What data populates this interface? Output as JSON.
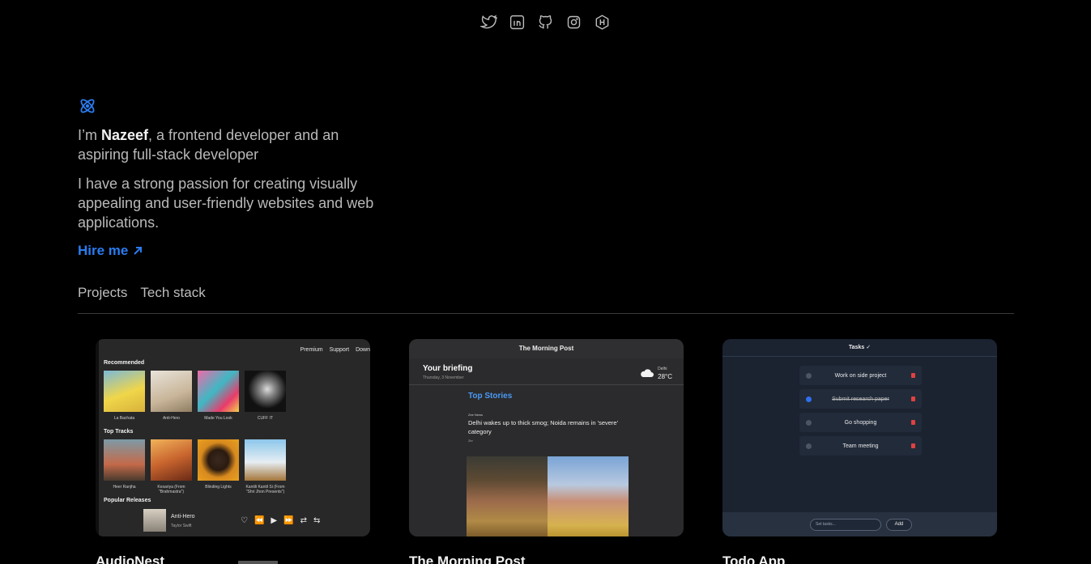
{
  "social": [
    "twitter-icon",
    "linkedin-icon",
    "github-icon",
    "instagram-icon",
    "hashnode-icon"
  ],
  "intro": {
    "prefix": "I’m ",
    "name": "Nazeef",
    "suffix": ", a frontend developer and an aspiring full-stack developer"
  },
  "passion": "I have a strong passion for creating visually appealing and user-friendly websites and web applications.",
  "hire_label": "Hire me",
  "tabs": [
    "Projects",
    "Tech stack"
  ],
  "colors": {
    "accent": "#2a7cf0",
    "background": "#000000"
  },
  "projects": [
    {
      "title": "AudioNest",
      "nav": [
        "Premium",
        "Support",
        "Down"
      ],
      "recommended_label": "Recommended",
      "recommended": [
        "La Bachata",
        "Anti-Hero",
        "Made You Look",
        "CUFF IT"
      ],
      "top_tracks_label": "Top Tracks",
      "top_tracks": [
        "Heer Ranjha",
        "Kesariya (From \"Brahmastra\")",
        "Blinding Lights",
        "Kantili Kantil Si (From \"Shri Jhon Presents\")"
      ],
      "popular_label": "Popular Releases",
      "now_playing": {
        "track": "Anti-Hero",
        "artist": "Taylor Swift"
      }
    },
    {
      "title": "The Morning Post",
      "header": "The Morning Post",
      "briefing": "Your briefing",
      "date": "Thursday, 3 November",
      "weather": {
        "city": "Delhi",
        "temp": "28°C"
      },
      "top_stories_label": "Top Stories",
      "source": "Zee News",
      "headline": "Delhi wakes up to thick smog; Noida remains in 'severe' category",
      "time": "2hr"
    },
    {
      "title": "Todo App",
      "header": "Tasks ✓",
      "tasks": [
        {
          "text": "Work on side project",
          "done": false
        },
        {
          "text": "Submit research paper",
          "done": true
        },
        {
          "text": "Go shopping",
          "done": false
        },
        {
          "text": "Team meeting",
          "done": false
        }
      ],
      "input_placeholder": "Set tasks...",
      "add_label": "Add"
    }
  ]
}
